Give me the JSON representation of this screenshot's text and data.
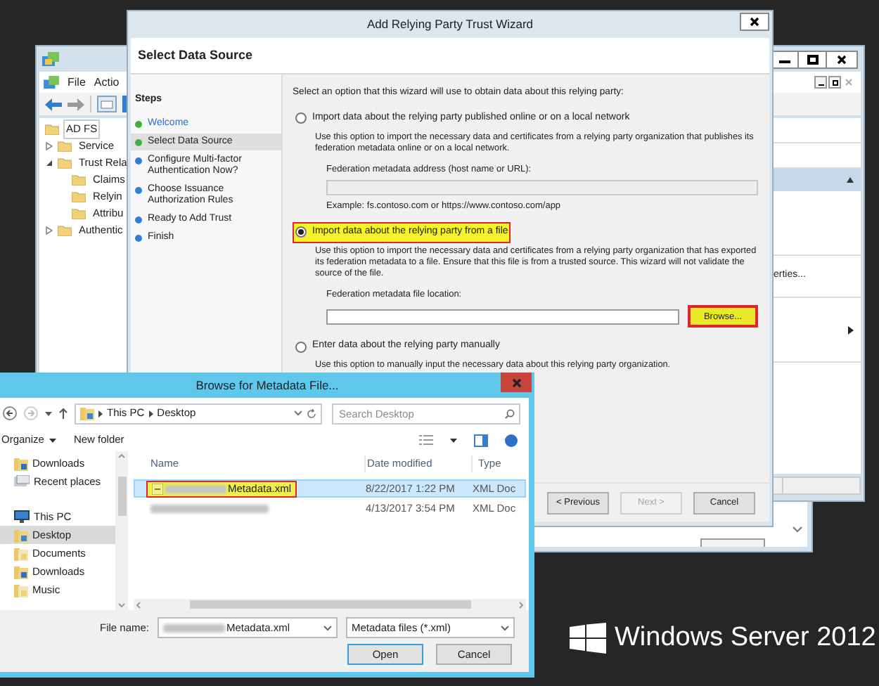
{
  "desktop": {
    "brand": "Windows Server 2012"
  },
  "console_window": {
    "menu": [
      "File",
      "Actio"
    ],
    "tree": [
      {
        "label": "AD FS",
        "selected": true,
        "children": [
          {
            "label": "Service",
            "selected": false,
            "expanded": false
          },
          {
            "label": "Trust Rela",
            "selected": false,
            "expanded": true,
            "children": [
              {
                "label": "Claims",
                "selected": false
              },
              {
                "label": "Relyin",
                "selected": false
              },
              {
                "label": "Attribu",
                "selected": false
              }
            ]
          },
          {
            "label": "Authentic",
            "selected": false,
            "expanded": false
          }
        ]
      }
    ],
    "action_item": "erties..."
  },
  "wizard": {
    "title": "Add Relying Party Trust Wizard",
    "heading": "Select Data Source",
    "steps_title": "Steps",
    "steps": [
      {
        "label": "Welcome",
        "kind": "link",
        "color": "#3fae49",
        "selected": false
      },
      {
        "label": "Select Data Source",
        "kind": "text",
        "color": "#3fae49",
        "selected": true
      },
      {
        "label": "Configure Multi-factor Authentication Now?",
        "kind": "text",
        "color": "#2f7fd6",
        "selected": false
      },
      {
        "label": "Choose Issuance Authorization Rules",
        "kind": "text",
        "color": "#2f7fd6",
        "selected": false
      },
      {
        "label": "Ready to Add Trust",
        "kind": "text",
        "color": "#2f7fd6",
        "selected": false
      },
      {
        "label": "Finish",
        "kind": "text",
        "color": "#2f7fd6",
        "selected": false
      }
    ],
    "intro": "Select an option that this wizard will use to obtain data about this relying party:",
    "options": [
      {
        "label": "Import data about the relying party published online or on a local network",
        "selected": false,
        "highlighted": false,
        "description": "Use this option to import the necessary data and certificates from a relying party organization that publishes its federation metadata online or on a local network.",
        "field": {
          "label": "Federation metadata address (host name or URL):",
          "disabled": true
        },
        "example": "Example: fs.contoso.com or https://www.contoso.com/app"
      },
      {
        "label": "Import data about the relying party from a file",
        "selected": true,
        "highlighted": true,
        "description": "Use this option to import the necessary data and certificates from a relying party organization that has exported its federation metadata to a file. Ensure that this file is from a trusted source.  This wizard will not validate the source of the file.",
        "field": {
          "label": "Federation metadata file location:",
          "disabled": false
        },
        "browse": {
          "label": "Browse...",
          "highlighted": true
        }
      },
      {
        "label": "Enter data about the relying party manually",
        "selected": false,
        "highlighted": false,
        "description": "Use this option to manually input the necessary data about this relying party organization."
      }
    ],
    "buttons": [
      {
        "label": "< Previous",
        "disabled": false
      },
      {
        "label": "Next >",
        "disabled": true
      },
      {
        "label": "Cancel",
        "disabled": false
      }
    ]
  },
  "file_dialog": {
    "title": "Browse for Metadata File...",
    "breadcrumb": [
      "This PC",
      "Desktop"
    ],
    "search": {
      "placeholder": "Search Desktop"
    },
    "toolbar": [
      {
        "label": "Organize",
        "dropdown": true
      },
      {
        "label": "New folder",
        "dropdown": false
      }
    ],
    "nav": [
      {
        "label": "Downloads",
        "kind": "download",
        "selected": false
      },
      {
        "label": "Recent places",
        "kind": "recent",
        "selected": false
      },
      {
        "label": "This PC",
        "kind": "pc",
        "selected": false
      },
      {
        "label": "Desktop",
        "kind": "desktop",
        "selected": true
      },
      {
        "label": "Documents",
        "kind": "folder",
        "selected": false
      },
      {
        "label": "Downloads",
        "kind": "download",
        "selected": false
      },
      {
        "label": "Music",
        "kind": "folder",
        "selected": false
      }
    ],
    "columns": [
      "Name",
      "Date modified",
      "Type"
    ],
    "rows": [
      {
        "name": "Metadata.xml",
        "redacted": true,
        "date": "8/22/2017 1:22 PM",
        "type": "XML Doc",
        "selected": true,
        "highlighted": true
      },
      {
        "redacted": true,
        "date": "4/13/2017 3:54 PM",
        "type": "XML Doc",
        "selected": false,
        "highlighted": false
      }
    ],
    "file_name": {
      "label": "File name:",
      "value": "Metadata.xml",
      "redacted": true
    },
    "filter": "Metadata files (*.xml)",
    "buttons": [
      "Open",
      "Cancel"
    ]
  }
}
